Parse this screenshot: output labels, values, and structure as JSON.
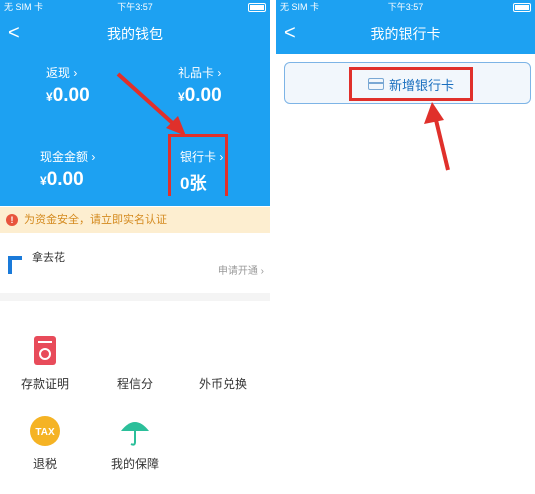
{
  "left": {
    "status": {
      "carrier": "无 SIM 卡",
      "time": "下午3:57"
    },
    "nav": {
      "back": "<",
      "title": "我的钱包"
    },
    "stats": [
      {
        "label": "返现",
        "value": "0.00",
        "currency": "¥"
      },
      {
        "label": "礼品卡",
        "value": "0.00",
        "currency": "¥"
      },
      {
        "label": "现金金额",
        "value": "0.00",
        "currency": "¥"
      },
      {
        "label": "银行卡",
        "value": "0张",
        "currency": ""
      }
    ],
    "notice": "为资金安全，请立即实名认证",
    "promo": {
      "title": "拿去花",
      "action": "申请开通"
    },
    "services": [
      {
        "label": "存款证明",
        "icon": "deposit-proof-icon"
      },
      {
        "label": "程信分",
        "icon": "credit-score-icon"
      },
      {
        "label": "外币兑换",
        "icon": "currency-exchange-icon"
      },
      {
        "label": "退税",
        "icon": "tax-refund-icon",
        "badge": "TAX"
      },
      {
        "label": "我的保障",
        "icon": "umbrella-icon"
      }
    ]
  },
  "right": {
    "status": {
      "carrier": "无 SIM 卡",
      "time": "下午3:57"
    },
    "nav": {
      "back": "<",
      "title": "我的银行卡"
    },
    "add_card_label": "新增银行卡"
  },
  "colors": {
    "header_blue": "#1da1f2",
    "highlight_red": "#e0302b",
    "notice_bg": "#fdeed0"
  }
}
